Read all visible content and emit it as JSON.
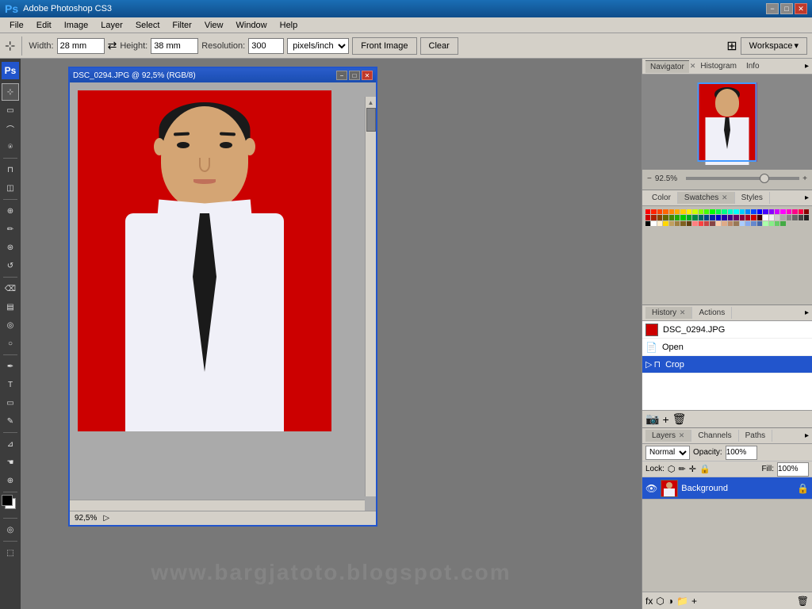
{
  "titlebar": {
    "title": "Adobe Photoshop CS3",
    "min_btn": "−",
    "max_btn": "□",
    "close_btn": "✕"
  },
  "menubar": {
    "items": [
      "File",
      "Edit",
      "Image",
      "Layer",
      "Select",
      "Filter",
      "View",
      "Window",
      "Help"
    ]
  },
  "toolbar": {
    "width_label": "Width:",
    "width_value": "28 mm",
    "height_label": "Height:",
    "height_value": "38 mm",
    "resolution_label": "Resolution:",
    "resolution_value": "300",
    "resolution_unit": "pixels/inch",
    "front_image_btn": "Front Image",
    "clear_btn": "Clear",
    "workspace_btn": "Workspace"
  },
  "document": {
    "title": "DSC_0294.JPG @ 92,5% (RGB/8)",
    "zoom": "92,5%",
    "close_btn": "✕",
    "min_btn": "−",
    "max_btn": "□"
  },
  "navigator": {
    "title": "Navigator",
    "histogram_tab": "Histogram",
    "info_tab": "Info",
    "zoom_pct": "92.5%",
    "zoom_minus": "−",
    "zoom_plus": "+"
  },
  "color_panel": {
    "color_tab": "Color",
    "swatches_tab": "Swatches",
    "styles_tab": "Styles",
    "swatches": [
      "#ff0000",
      "#ff2200",
      "#ff4400",
      "#ff6600",
      "#ff8800",
      "#ffaa00",
      "#ffcc00",
      "#ffee00",
      "#ccff00",
      "#88ff00",
      "#44ff00",
      "#00ff00",
      "#00ff44",
      "#00ff88",
      "#00ffcc",
      "#00ffff",
      "#00ccff",
      "#0088ff",
      "#0044ff",
      "#0000ff",
      "#4400ff",
      "#8800ff",
      "#cc00ff",
      "#ff00ff",
      "#ff00cc",
      "#ff0088",
      "#ff0044",
      "#880000",
      "#cc0000",
      "#aa2200",
      "#884400",
      "#666600",
      "#448800",
      "#22aa00",
      "#00cc00",
      "#00aa22",
      "#008844",
      "#006666",
      "#004488",
      "#0022aa",
      "#0000cc",
      "#2200aa",
      "#440088",
      "#660066",
      "#880044",
      "#aa0022",
      "#cc0000",
      "#440000",
      "#ffffff",
      "#eeeeee",
      "#cccccc",
      "#aaaaaa",
      "#888888",
      "#666666",
      "#444444",
      "#222222",
      "#000000",
      "#ffffff",
      "#ffeecc",
      "#ffd700",
      "#c0a060",
      "#a08040",
      "#806020",
      "#604010",
      "#ff8080",
      "#ff4040",
      "#cc4444",
      "#884444",
      "#ffccaa",
      "#ddaa88",
      "#bb8866",
      "#997755",
      "#aaccff",
      "#88aaee",
      "#6688cc",
      "#4466aa",
      "#aaffaa",
      "#88ee88",
      "#66cc66",
      "#44aa44"
    ]
  },
  "history_panel": {
    "history_tab": "History",
    "actions_tab": "Actions",
    "items": [
      {
        "label": "DSC_0294.JPG",
        "type": "file"
      },
      {
        "label": "Open",
        "type": "open"
      },
      {
        "label": "Crop",
        "type": "crop",
        "active": true
      }
    ]
  },
  "layers_panel": {
    "layers_tab": "Layers",
    "channels_tab": "Channels",
    "paths_tab": "Paths",
    "blend_mode": "Normal",
    "opacity_label": "Opacity:",
    "opacity_value": "100%",
    "fill_label": "Fill:",
    "fill_value": "100%",
    "lock_label": "Lock:",
    "layers": [
      {
        "name": "Background",
        "visible": true,
        "active": true
      }
    ]
  },
  "tools": [
    "move",
    "marquee",
    "lasso",
    "magic-wand",
    "crop",
    "slice",
    "heal",
    "brush",
    "stamp",
    "history-brush",
    "eraser",
    "gradient",
    "blur",
    "dodge",
    "pen",
    "text",
    "shape",
    "notes",
    "eyedropper",
    "hand",
    "zoom"
  ],
  "colors": {
    "foreground": "#000000",
    "background": "#ffffff",
    "accent": "#2255cc"
  },
  "watermark": "www.bargjatoto.blogspot.com"
}
